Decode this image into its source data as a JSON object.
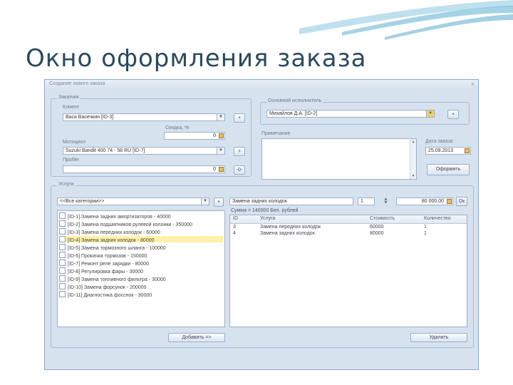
{
  "slide_title": "Окно оформления заказа",
  "window": {
    "title": "Создание нового заказа",
    "close": "×"
  },
  "order": {
    "legend": "Заказчик",
    "client_label": "Клиент",
    "client_value": "Вася Васечкин [ID-3]",
    "discount_label": "Скидка, %",
    "discount_value": "0",
    "moto_label": "Мотоцикл",
    "moto_value": "Suzuki Bandit 400 74 - 58 RU [ID-7]",
    "mileage_label": "Пробег",
    "mileage_value": "0",
    "plus": "+",
    "minus": "-0-"
  },
  "executor": {
    "legend": "Основной исполнитель",
    "value": "Михайлов Д.А. [ID-2]",
    "plus": "+"
  },
  "notes_label": "Примечание",
  "order_date": {
    "label": "Дата заказа",
    "value": "25.09.2013"
  },
  "submit_label": "Оформить",
  "services": {
    "legend": "Услуги",
    "category_value": "<<Все категории>>",
    "plus": "+",
    "items": [
      {
        "text": "[ID-1] Замена задних амортизаторов - 40000",
        "selected": false
      },
      {
        "text": "[ID-2] Замена подшипников рулевой колонки - 350000",
        "selected": false
      },
      {
        "text": "[ID-3] Замена передних колодок - 60000",
        "selected": false
      },
      {
        "text": "[ID-4] Замена задних колодок - 80000",
        "selected": true
      },
      {
        "text": "[ID-5] Замена тормозного шланга - 100000",
        "selected": false
      },
      {
        "text": "[ID-6] Прокачка тормозов - 150000",
        "selected": false
      },
      {
        "text": "[ID-7] Ремонт реле зарядки - 80000",
        "selected": false
      },
      {
        "text": "[ID-8] Регулировка фары - 30000",
        "selected": false
      },
      {
        "text": "[ID-9] Замена топливного фильтра - 30000",
        "selected": false
      },
      {
        "text": "[ID-10] Замена форсунок - 200000",
        "selected": false
      },
      {
        "text": "[ID-11] Диагностика фосснок - 30000",
        "selected": false
      }
    ],
    "add_label": "Добавить =>",
    "selected_name": "Замена задних колодок",
    "qty": "1",
    "price": "80 000,00",
    "ok": "Ок",
    "sum_text": "Сумма = 140000 Бел. рублей",
    "columns": [
      "ID",
      "Услуга",
      "Стоимость",
      "Количество"
    ],
    "rows": [
      [
        "3",
        "Замена передних колодок",
        "60000",
        "1"
      ],
      [
        "4",
        "Замена задних колодок",
        "80000",
        "1"
      ]
    ],
    "delete_label": "Удалить"
  }
}
